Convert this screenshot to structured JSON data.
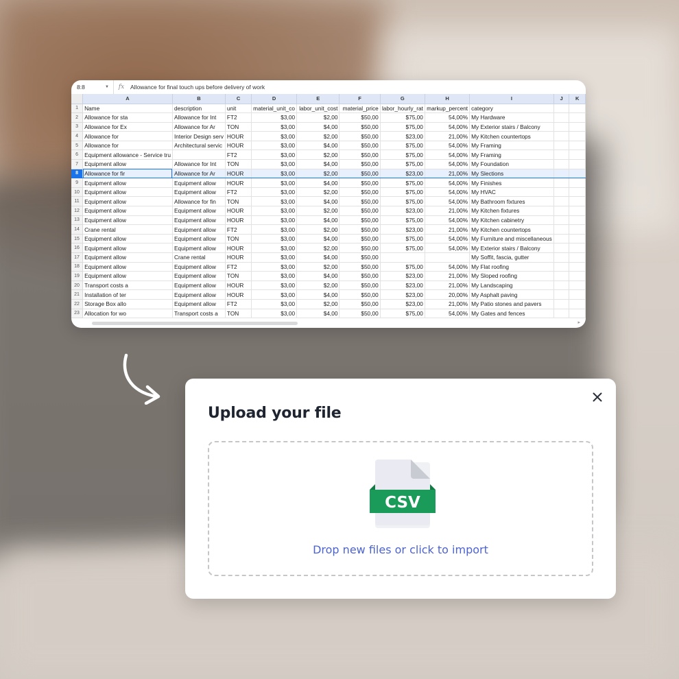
{
  "spreadsheet": {
    "cell_ref": "8:8",
    "fx_label": "fx",
    "formula": "Allowance for final touch ups before delivery of work",
    "selected_row": "8",
    "columns": [
      "A",
      "B",
      "C",
      "D",
      "E",
      "F",
      "G",
      "H",
      "I",
      "J",
      "K"
    ],
    "rows": [
      {
        "n": "1",
        "cells": [
          "Name",
          "description",
          "unit",
          "material_unit_co",
          "labor_unit_cost",
          "material_price",
          "labor_hourly_rat",
          "markup_percent",
          "category",
          "",
          ""
        ]
      },
      {
        "n": "2",
        "cells": [
          "Allowance for sta",
          "Allowance for Int",
          "FT2",
          "$3,00",
          "$2,00",
          "$50,00",
          "$75,00",
          "54,00%",
          "My Hardware",
          "",
          ""
        ]
      },
      {
        "n": "3",
        "cells": [
          "Allowance for Ex",
          "Allowance for Ar",
          "TON",
          "$3,00",
          "$4,00",
          "$50,00",
          "$75,00",
          "54,00%",
          "My Exterior stairs / Balcony",
          "",
          ""
        ]
      },
      {
        "n": "4",
        "cells": [
          "Allowance for",
          "Interior Design serv",
          "HOUR",
          "$3,00",
          "$2,00",
          "$50,00",
          "$23,00",
          "21,00%",
          "My Kitchen countertops",
          "",
          ""
        ]
      },
      {
        "n": "5",
        "cells": [
          "Allowance for",
          "Architectural servic",
          "HOUR",
          "$3,00",
          "$4,00",
          "$50,00",
          "$75,00",
          "54,00%",
          "My Framing",
          "",
          ""
        ]
      },
      {
        "n": "6",
        "cells": [
          "Equipment allowance - Service tru",
          "",
          "FT2",
          "$3,00",
          "$2,00",
          "$50,00",
          "$75,00",
          "54,00%",
          "My Framing",
          "",
          ""
        ]
      },
      {
        "n": "7",
        "cells": [
          "Equipment allow",
          "Allowance for Int",
          "TON",
          "$3,00",
          "$4,00",
          "$50,00",
          "$75,00",
          "54,00%",
          "My Foundation",
          "",
          ""
        ]
      },
      {
        "n": "8",
        "cells": [
          "Allowance for fir",
          "Allowance for Ar",
          "HOUR",
          "$3,00",
          "$2,00",
          "$50,00",
          "$23,00",
          "21,00%",
          "My Slections",
          "",
          ""
        ]
      },
      {
        "n": "9",
        "cells": [
          "Equipment allow",
          "Equipment allow",
          "HOUR",
          "$3,00",
          "$4,00",
          "$50,00",
          "$75,00",
          "54,00%",
          "My Finishes",
          "",
          ""
        ]
      },
      {
        "n": "10",
        "cells": [
          "Equipment allow",
          "Equipment allow",
          "FT2",
          "$3,00",
          "$2,00",
          "$50,00",
          "$75,00",
          "54,00%",
          "My HVAC",
          "",
          ""
        ]
      },
      {
        "n": "11",
        "cells": [
          "Equipment allow",
          "Allowance for fin",
          "TON",
          "$3,00",
          "$4,00",
          "$50,00",
          "$75,00",
          "54,00%",
          "My Bathroom fixtures",
          "",
          ""
        ]
      },
      {
        "n": "12",
        "cells": [
          "Equipment allow",
          "Equipment allow",
          "HOUR",
          "$3,00",
          "$2,00",
          "$50,00",
          "$23,00",
          "21,00%",
          "My Kitchen fixtures",
          "",
          ""
        ]
      },
      {
        "n": "13",
        "cells": [
          "Equipment allow",
          "Equipment allow",
          "HOUR",
          "$3,00",
          "$4,00",
          "$50,00",
          "$75,00",
          "54,00%",
          "My Kitchen cabinetry",
          "",
          ""
        ]
      },
      {
        "n": "14",
        "cells": [
          "Crane rental",
          "Equipment allow",
          "FT2",
          "$3,00",
          "$2,00",
          "$50,00",
          "$23,00",
          "21,00%",
          "My Kitchen countertops",
          "",
          ""
        ]
      },
      {
        "n": "15",
        "cells": [
          "Equipment allow",
          "Equipment allow",
          "TON",
          "$3,00",
          "$4,00",
          "$50,00",
          "$75,00",
          "54,00%",
          "My Furniture and miscellaneous",
          "",
          ""
        ]
      },
      {
        "n": "16",
        "cells": [
          "Equipment allow",
          "Equipment allow",
          "HOUR",
          "$3,00",
          "$2,00",
          "$50,00",
          "$75,00",
          "54,00%",
          "My Exterior stairs / Balcony",
          "",
          ""
        ]
      },
      {
        "n": "17",
        "cells": [
          "Equipment allow",
          "Crane rental",
          "HOUR",
          "$3,00",
          "$4,00",
          "$50,00",
          "",
          "",
          "My Soffit, fascia, gutter",
          "",
          ""
        ]
      },
      {
        "n": "18",
        "cells": [
          "Equipment allow",
          "Equipment allow",
          "FT2",
          "$3,00",
          "$2,00",
          "$50,00",
          "$75,00",
          "54,00%",
          "My Flat roofing",
          "",
          ""
        ]
      },
      {
        "n": "19",
        "cells": [
          "Equipment allow",
          "Equipment allow",
          "TON",
          "$3,00",
          "$4,00",
          "$50,00",
          "$23,00",
          "21,00%",
          "My Sloped roofing",
          "",
          ""
        ]
      },
      {
        "n": "20",
        "cells": [
          "Transport costs a",
          "Equipment allow",
          "HOUR",
          "$3,00",
          "$2,00",
          "$50,00",
          "$23,00",
          "21,00%",
          "My Landscaping",
          "",
          ""
        ]
      },
      {
        "n": "21",
        "cells": [
          "Installation of ter",
          "Equipment allow",
          "HOUR",
          "$3,00",
          "$4,00",
          "$50,00",
          "$23,00",
          "20,00%",
          "My Asphalt paving",
          "",
          ""
        ]
      },
      {
        "n": "22",
        "cells": [
          "Storage Box allo",
          "Equipment allow",
          "FT2",
          "$3,00",
          "$2,00",
          "$50,00",
          "$23,00",
          "21,00%",
          "My Patio stones and pavers",
          "",
          ""
        ]
      },
      {
        "n": "23",
        "cells": [
          "Allocation for wo",
          "Transport costs a",
          "TON",
          "$3,00",
          "$4,00",
          "$50,00",
          "$75,00",
          "54,00%",
          "My Gates and fences",
          "",
          ""
        ]
      }
    ]
  },
  "upload_modal": {
    "title": "Upload your file",
    "close_symbol": "×",
    "file_badge": "CSV",
    "drop_text": "Drop new files or click to import",
    "badge_color": "#1a9b5a",
    "link_color": "#4c63d2"
  }
}
